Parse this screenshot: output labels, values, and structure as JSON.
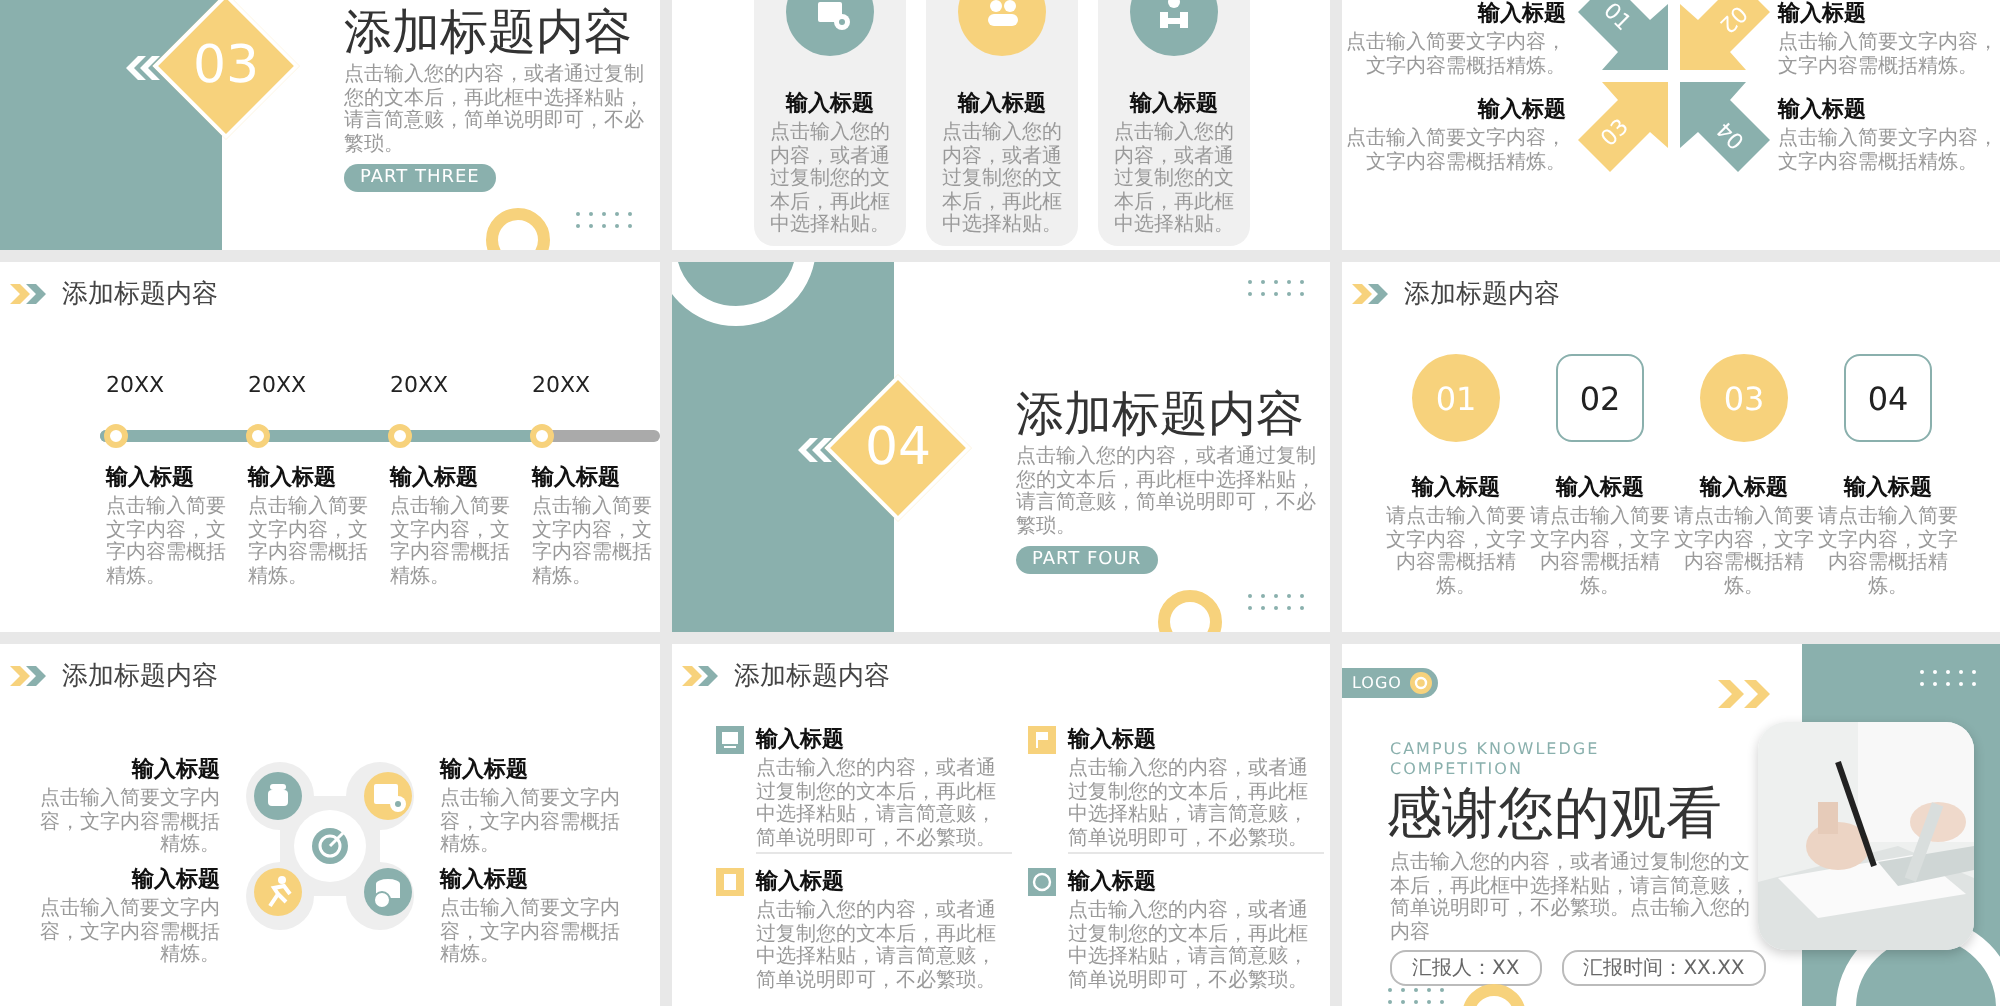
{
  "slides": [
    {
      "kind": "section",
      "number": "03",
      "title": "添加标题内容",
      "text": "点击输入您的内容，或者通过复制您的文本后，再此框中选择粘贴，请言简意赅，简单说明即可，不必繁琐。",
      "tag": "PART THREE"
    },
    {
      "kind": "cards",
      "items": [
        {
          "title": "输入标题",
          "text": "点击输入您的内容，或者通过复制您的文本后，再此框中选择粘贴。",
          "color": "#8ab0ad"
        },
        {
          "title": "输入标题",
          "text": "点击输入您的内容，或者通过复制您的文本后，再此框中选择粘贴。",
          "color": "#f7d27c"
        },
        {
          "title": "输入标题",
          "text": "点击输入您的内容，或者通过复制您的文本后，再此框中选择粘贴。",
          "color": "#8ab0ad"
        }
      ]
    },
    {
      "kind": "arrows",
      "items": [
        {
          "number": "01",
          "title": "输入标题",
          "text": "点击输入简要文字内容，文字内容需概括精炼。",
          "color": "#8ab0ad"
        },
        {
          "number": "02",
          "title": "输入标题",
          "text": "点击输入简要文字内容，文字内容需概括精炼。",
          "color": "#f7d27c"
        },
        {
          "number": "03",
          "title": "输入标题",
          "text": "点击输入简要文字内容，文字内容需概括精炼。",
          "color": "#f7d27c"
        },
        {
          "number": "04",
          "title": "输入标题",
          "text": "点击输入简要文字内容，文字内容需概括精炼。",
          "color": "#8ab0ad"
        }
      ]
    },
    {
      "kind": "timeline",
      "header": "添加标题内容",
      "level": 0.79,
      "items": [
        {
          "year": "20XX",
          "title": "输入标题",
          "text": "点击输入简要文字内容，文字内容需概括精炼。"
        },
        {
          "year": "20XX",
          "title": "输入标题",
          "text": "点击输入简要文字内容，文字内容需概括精炼。"
        },
        {
          "year": "20XX",
          "title": "输入标题",
          "text": "点击输入简要文字内容，文字内容需概括精炼。"
        },
        {
          "year": "20XX",
          "title": "输入标题",
          "text": "点击输入简要文字内容，文字内容需概括精炼。"
        }
      ]
    },
    {
      "kind": "section",
      "number": "04",
      "title": "添加标题内容",
      "text": "点击输入您的内容，或者通过复制您的文本后，再此框中选择粘贴，请言简意赅，简单说明即可，不必繁琐。",
      "tag": "PART FOUR"
    },
    {
      "kind": "numbers",
      "header": "添加标题内容",
      "items": [
        {
          "number": "01",
          "filled": true,
          "title": "输入标题",
          "text": "请点击输入简要文字内容，文字内容需概括精炼。"
        },
        {
          "number": "02",
          "filled": false,
          "title": "输入标题",
          "text": "请点击输入简要文字内容，文字内容需概括精炼。"
        },
        {
          "number": "03",
          "filled": true,
          "title": "输入标题",
          "text": "请点击输入简要文字内容，文字内容需概括精炼。"
        },
        {
          "number": "04",
          "filled": false,
          "title": "输入标题",
          "text": "请点击输入简要文字内容，文字内容需概括精炼。"
        }
      ]
    },
    {
      "kind": "hub",
      "header": "添加标题内容",
      "items": [
        {
          "title": "输入标题",
          "text": "点击输入简要文字内容，文字内容需概括精炼。",
          "color": "#8ab0ad"
        },
        {
          "title": "输入标题",
          "text": "点击输入简要文字内容，文字内容需概括精炼。",
          "color": "#f7d27c"
        },
        {
          "title": "输入标题",
          "text": "点击输入简要文字内容，文字内容需概括精炼。",
          "color": "#f7d27c"
        },
        {
          "title": "输入标题",
          "text": "点击输入简要文字内容，文字内容需概括精炼。",
          "color": "#8ab0ad"
        }
      ]
    },
    {
      "kind": "list",
      "header": "添加标题内容",
      "items": [
        {
          "title": "输入标题",
          "text": "点击输入您的内容，或者通过复制您的文本后，再此框中选择粘贴，请言简意赅，简单说明即可，不必繁琐。",
          "color": "#8ab0ad"
        },
        {
          "title": "输入标题",
          "text": "点击输入您的内容，或者通过复制您的文本后，再此框中选择粘贴，请言简意赅，简单说明即可，不必繁琐。",
          "color": "#f7d27c"
        },
        {
          "title": "输入标题",
          "text": "点击输入您的内容，或者通过复制您的文本后，再此框中选择粘贴，请言简意赅，简单说明即可，不必繁琐。",
          "color": "#f7d27c"
        },
        {
          "title": "输入标题",
          "text": "点击输入您的内容，或者通过复制您的文本后，再此框中选择粘贴，请言简意赅，简单说明即可，不必繁琐。",
          "color": "#8ab0ad"
        }
      ]
    },
    {
      "kind": "closing",
      "logo": "LOGO",
      "subtitle": "CAMPUS KNOWLEDGE COMPETITION",
      "title": "感谢您的观看",
      "text": "点击输入您的内容，或者通过复制您的文本后，再此框中选择粘贴，请言简意赅，简单说明即可，不必繁琐。点击输入您的内容",
      "fields": [
        "汇报人：XX",
        "汇报时间：XX.XX"
      ]
    }
  ]
}
